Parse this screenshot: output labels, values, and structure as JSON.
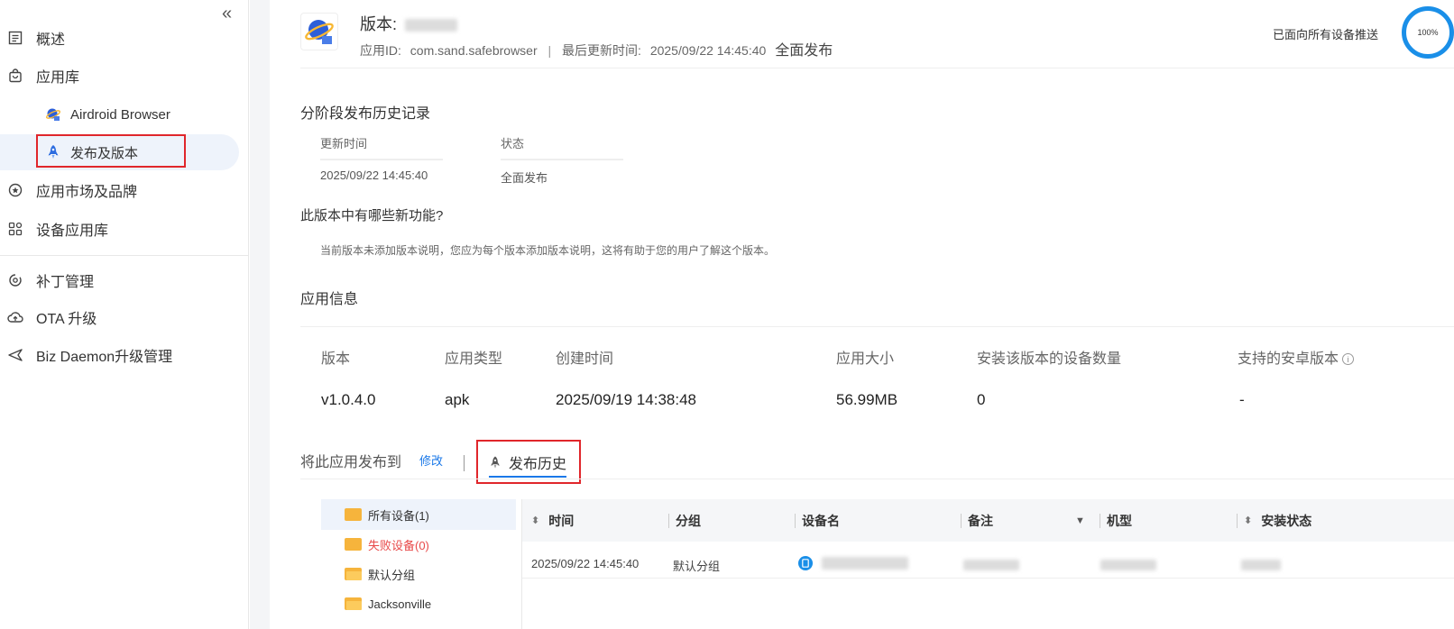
{
  "sidebar": {
    "items": [
      {
        "label": "概述",
        "icon": "document-list-icon"
      },
      {
        "label": "应用库",
        "icon": "bag-icon"
      },
      {
        "label": "Airdroid Browser",
        "icon": "app-browser-icon"
      },
      {
        "label": "发布及版本",
        "icon": "rocket-icon"
      },
      {
        "label": "应用市场及品牌",
        "icon": "star-circle-icon"
      },
      {
        "label": "设备应用库",
        "icon": "grid-icon"
      },
      {
        "label": "补丁管理",
        "icon": "patch-icon"
      },
      {
        "label": "OTA 升级",
        "icon": "cloud-upload-icon"
      },
      {
        "label": "Biz Daemon升级管理",
        "icon": "send-icon"
      }
    ]
  },
  "header": {
    "version_label": "版本:",
    "app_id_label": "应用ID:",
    "app_id": "com.sand.safebrowser",
    "updated_label": "最后更新时间:",
    "updated_time": "2025/09/22 14:45:40",
    "release_state": "全面发布",
    "push_text": "已面向所有设备推送",
    "progress_text": "100%",
    "progress_value": 100
  },
  "history": {
    "title": "分阶段发布历史记录",
    "col_time": "更新时间",
    "col_status": "状态",
    "row_time": "2025/09/22 14:45:40",
    "row_status": "全面发布"
  },
  "whats_new": {
    "title": "此版本中有哪些新功能?",
    "desc": "当前版本未添加版本说明，您应为每个版本添加版本说明，这将有助于您的用户了解这个版本。"
  },
  "app_info": {
    "title": "应用信息",
    "headers": [
      "版本",
      "应用类型",
      "创建时间",
      "应用大小",
      "安装该版本的设备数量",
      "支持的安卓版本"
    ],
    "values": [
      "v1.0.4.0",
      "apk",
      "2025/09/19 14:38:48",
      "56.99MB",
      "0",
      "-"
    ]
  },
  "tabs": {
    "publish_to": "将此应用发布到",
    "modify": "修改",
    "history": "发布历史"
  },
  "tree": [
    {
      "label": "所有设备(1)",
      "color": "#333333"
    },
    {
      "label": "失败设备(0)",
      "color": "#e84a4a"
    },
    {
      "label": "默认分组",
      "color": "#333333"
    },
    {
      "label": "Jacksonville",
      "color": "#333333"
    }
  ],
  "table": {
    "headers": [
      "时间",
      "分组",
      "设备名",
      "备注",
      "机型",
      "安装状态"
    ],
    "row": {
      "time": "2025/09/22 14:45:40",
      "group": "默认分组"
    }
  },
  "colors": {
    "accent": "#1a78e8",
    "highlight": "#e0262b",
    "folder": "#f6b43c"
  }
}
